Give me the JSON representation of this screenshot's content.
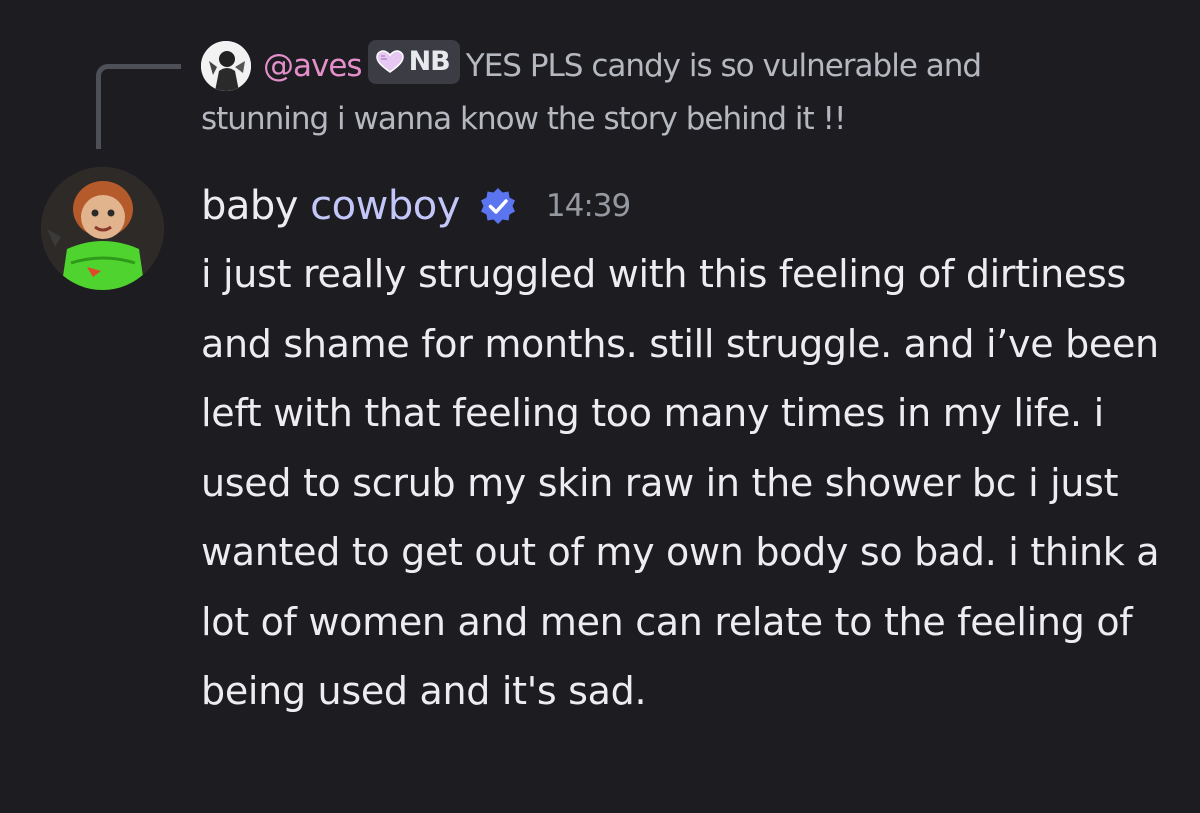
{
  "reply": {
    "username": "@aves",
    "tag_label": "NB",
    "tag_icon": "heart-icon",
    "text": "YES PLS candy is so vulnerable and stunning i wanna know the story behind it !!"
  },
  "message": {
    "username_first": "baby",
    "username_second": " cowboy",
    "verified_icon": "verified-badge-icon",
    "timestamp": "14:39",
    "content": "i just really struggled with this feeling of dirtiness and shame for months. still struggle. and i’ve been left with that feeling too many times in my life. i used to scrub my skin raw in the shower bc i just wanted to get out of my own body so bad. i think a lot of women and men can relate to the feeling of being used and it's sad."
  },
  "colors": {
    "background": "#1c1c21",
    "reply_username": "#e48fc9",
    "username": "#c3c6f8",
    "verified": "#5b74f0"
  }
}
